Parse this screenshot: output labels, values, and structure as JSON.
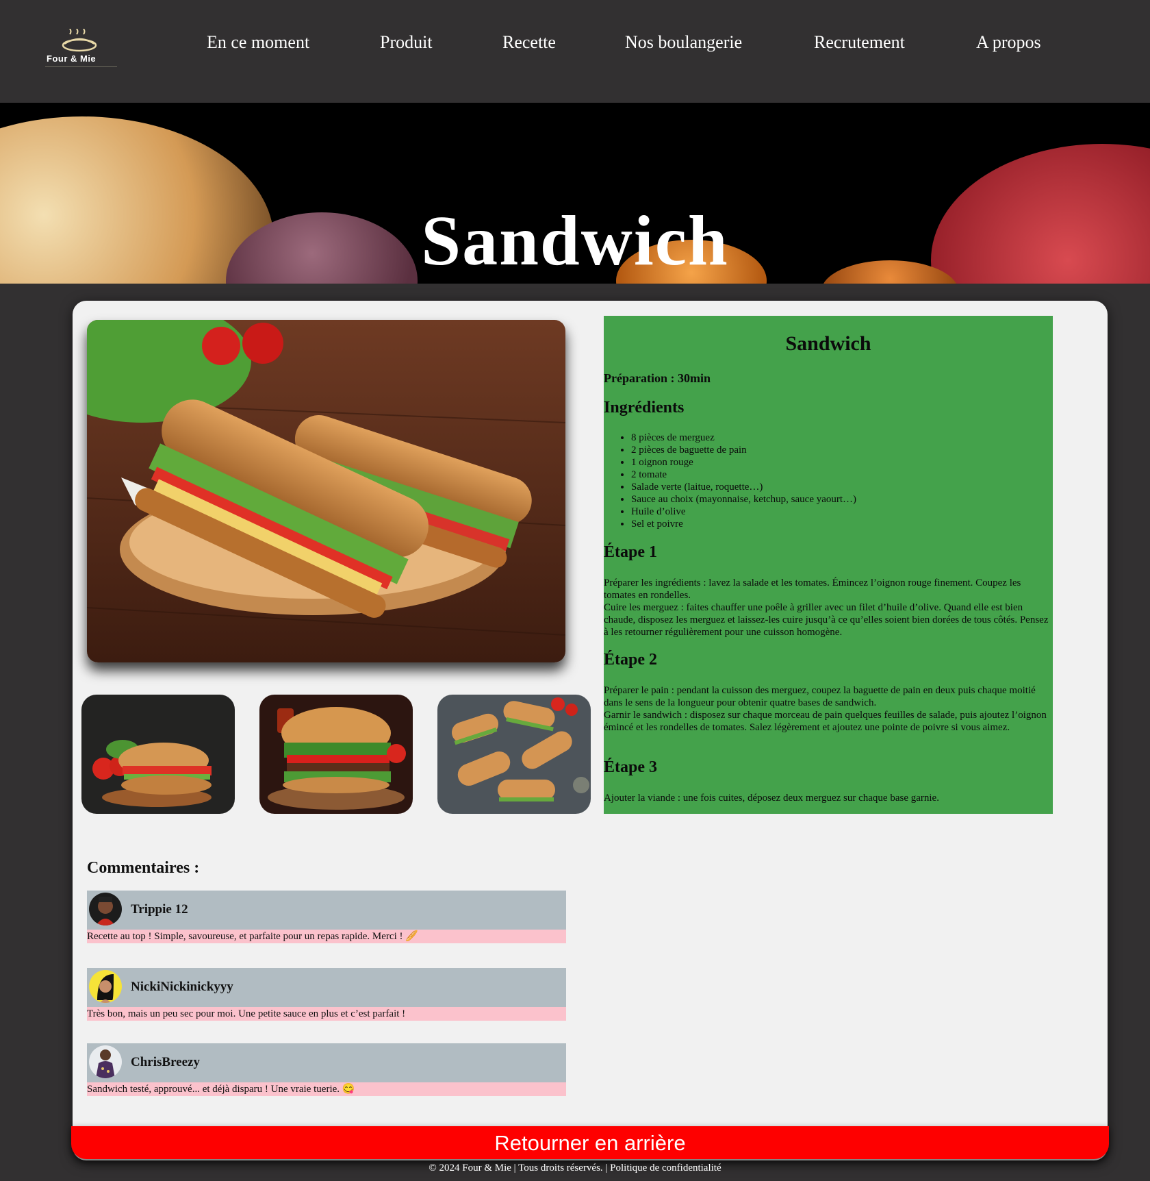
{
  "header": {
    "logo_text": "Four & Mie",
    "nav": [
      "En ce moment",
      "Produit",
      "Recette",
      "Nos boulangerie",
      "Recrutement",
      "A propos"
    ]
  },
  "hero": {
    "title": "Sandwich"
  },
  "recipe": {
    "title": "Sandwich",
    "preparation": "Préparation : 30min",
    "ingredients_title": "Ingrédients",
    "ingredients": [
      "8 pièces de merguez",
      "2 pièces de baguette de pain",
      "1 oignon rouge",
      "2 tomate",
      "Salade verte (laitue, roquette…)",
      "Sauce au choix (mayonnaise, ketchup, sauce yaourt…)",
      "Huile d’olive",
      "Sel et poivre"
    ],
    "steps": [
      {
        "title": "Étape 1",
        "lines": [
          "Préparer les ingrédients : lavez la salade et les tomates. Émincez l’oignon rouge finement. Coupez les tomates en rondelles.",
          "Cuire les merguez : faites chauffer une poêle à griller avec un filet d’huile d’olive. Quand elle est bien chaude, disposez les merguez et laissez-les cuire jusqu’à ce qu’elles soient bien dorées de tous côtés. Pensez à les retourner régulièrement pour une cuisson homogène."
        ]
      },
      {
        "title": "Étape 2",
        "lines": [
          "Préparer le pain : pendant la cuisson des merguez, coupez la baguette de pain en deux puis chaque moitié dans le sens de la longueur pour obtenir quatre bases de sandwich.",
          "Garnir le sandwich : disposez sur chaque morceau de pain quelques feuilles de salade, puis ajoutez l’oignon émincé et les rondelles de tomates. Salez légèrement et ajoutez une pointe de poivre si vous aimez."
        ]
      },
      {
        "title": "Étape 3",
        "lines": [
          "Ajouter la viande : une fois cuites, déposez deux merguez sur chaque base garnie."
        ]
      }
    ]
  },
  "comments": {
    "title": "Commentaires :",
    "items": [
      {
        "name": "Trippie 12",
        "text": "Recette au top ! Simple, savoureuse, et parfaite pour un repas rapide. Merci ! 🥖"
      },
      {
        "name": "NickiNickinickyyy",
        "text": "Très bon, mais un peu sec pour moi. Une petite sauce en plus et c’est parfait !"
      },
      {
        "name": "ChrisBreezy",
        "text": "Sandwich testé, approuvé... et déjà disparu ! Une vraie tuerie. 😋"
      }
    ]
  },
  "back_button": "Retourner en arrière",
  "footer": "© 2024 Four & Mie | Tous droits réservés. | Politique de confidentialité",
  "colors": {
    "page_bg": "#323031",
    "recipe_bg": "#44a24b",
    "comment_head": "#b1bcc2",
    "comment_body": "#fbc2cc",
    "back_button": "#fe0000"
  }
}
